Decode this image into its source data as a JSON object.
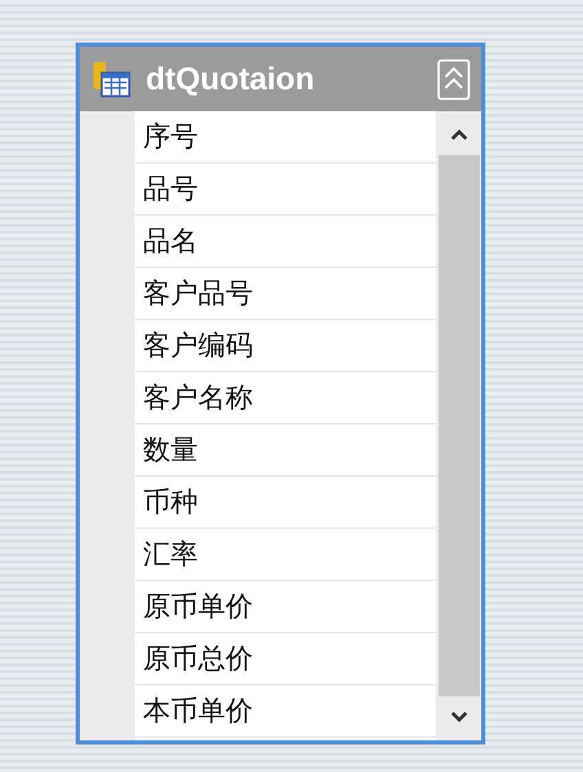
{
  "table": {
    "title": "dtQuotaion",
    "columns": [
      "序号",
      "品号",
      "品名",
      "客户品号",
      "客户编码",
      "客户名称",
      "数量",
      "币种",
      "汇率",
      "原币单价",
      "原币总价",
      "本币单价"
    ]
  }
}
